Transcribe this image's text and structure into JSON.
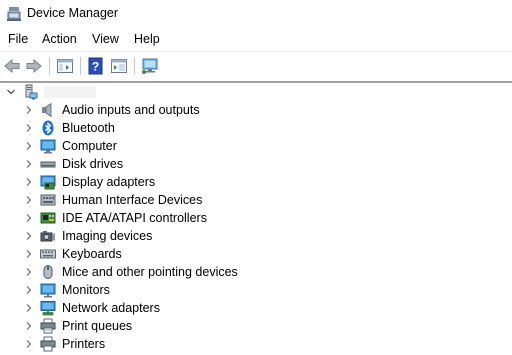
{
  "window": {
    "title": "Device Manager"
  },
  "menu": [
    "File",
    "Action",
    "View",
    "Help"
  ],
  "toolbar": {
    "buttons": [
      "back-arrow-icon",
      "forward-arrow-icon",
      "show-hide-console-tree-icon",
      "help-icon",
      "properties-pane-icon",
      "scan-hardware-monitor-icon"
    ]
  },
  "tree": {
    "root_name": "",
    "categories": [
      {
        "label": "Audio inputs and outputs",
        "icon": "speaker-icon"
      },
      {
        "label": "Bluetooth",
        "icon": "bluetooth-icon"
      },
      {
        "label": "Computer",
        "icon": "computer-icon"
      },
      {
        "label": "Disk drives",
        "icon": "disk-drive-icon"
      },
      {
        "label": "Display adapters",
        "icon": "display-adapter-icon"
      },
      {
        "label": "Human Interface Devices",
        "icon": "hid-icon"
      },
      {
        "label": "IDE ATA/ATAPI controllers",
        "icon": "ide-controller-icon"
      },
      {
        "label": "Imaging devices",
        "icon": "camera-icon"
      },
      {
        "label": "Keyboards",
        "icon": "keyboard-icon"
      },
      {
        "label": "Mice and other pointing devices",
        "icon": "mouse-icon"
      },
      {
        "label": "Monitors",
        "icon": "monitor-icon"
      },
      {
        "label": "Network adapters",
        "icon": "network-adapter-icon"
      },
      {
        "label": "Print queues",
        "icon": "print-queue-icon"
      },
      {
        "label": "Printers",
        "icon": "printer-icon"
      }
    ]
  },
  "colors": {
    "accent": "#1f6fd1",
    "divider": "#a0a0a0",
    "chevron": "#606060"
  }
}
